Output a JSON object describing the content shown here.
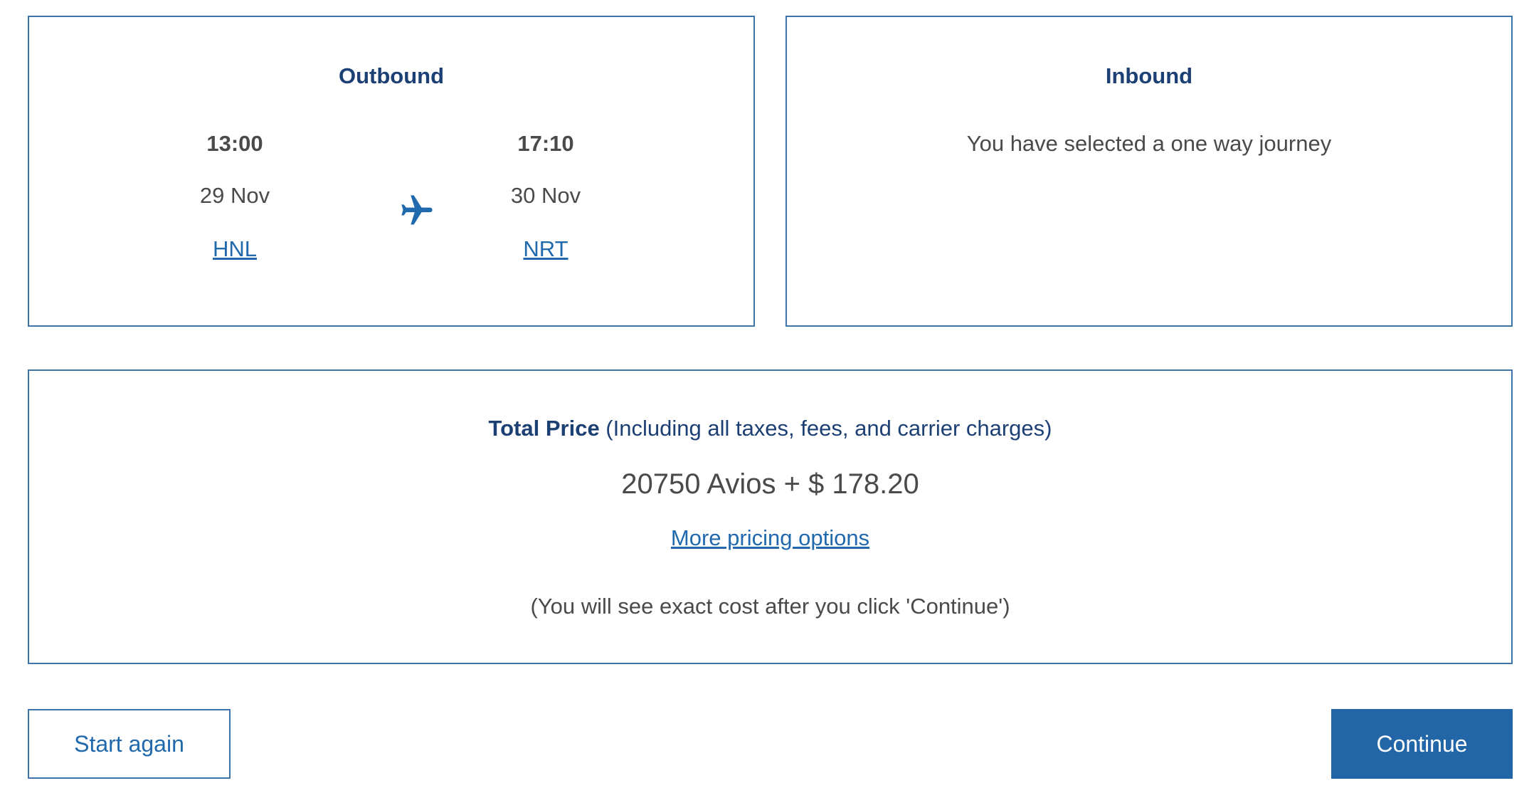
{
  "outbound": {
    "title": "Outbound",
    "departure": {
      "time": "13:00",
      "date": "29 Nov",
      "airport": "HNL"
    },
    "arrival": {
      "time": "17:10",
      "date": "30 Nov",
      "airport": "NRT"
    },
    "icon": "plane-icon"
  },
  "inbound": {
    "title": "Inbound",
    "message": "You have selected a one way journey"
  },
  "price": {
    "label": "Total Price",
    "label_note": " (Including all taxes, fees, and carrier charges)",
    "value": "20750 Avios + $ 178.20",
    "more_options_link": "More pricing options",
    "note": "(You will see exact cost after you click 'Continue')"
  },
  "actions": {
    "start_again": "Start again",
    "continue": "Continue"
  },
  "colors": {
    "brand_navy": "#1c3f74",
    "link_blue": "#2169ad",
    "border_blue": "#3f74a8",
    "button_blue": "#2366a8"
  }
}
